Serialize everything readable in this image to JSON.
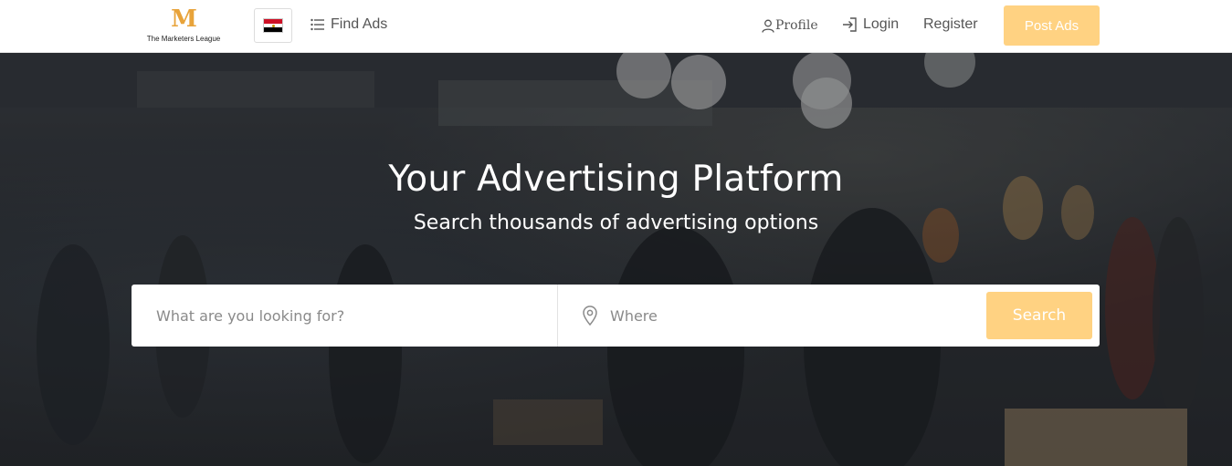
{
  "header": {
    "logo_text": "The Marketers League",
    "logo_mark": "M",
    "flag_icon": "egypt-flag-icon",
    "find_ads_label": "Find Ads",
    "profile_label": "Profile",
    "login_label": "Login",
    "register_label": "Register",
    "post_ads_label": "Post Ads"
  },
  "hero": {
    "title": "Your Advertising Platform",
    "subtitle": "Search thousands of advertising options"
  },
  "search": {
    "what_placeholder": "What are you looking for?",
    "where_placeholder": "Where",
    "button_label": "Search"
  },
  "colors": {
    "accent": "#ffd282",
    "logo": "#e8a33a",
    "header_bg": "#ffffff"
  }
}
